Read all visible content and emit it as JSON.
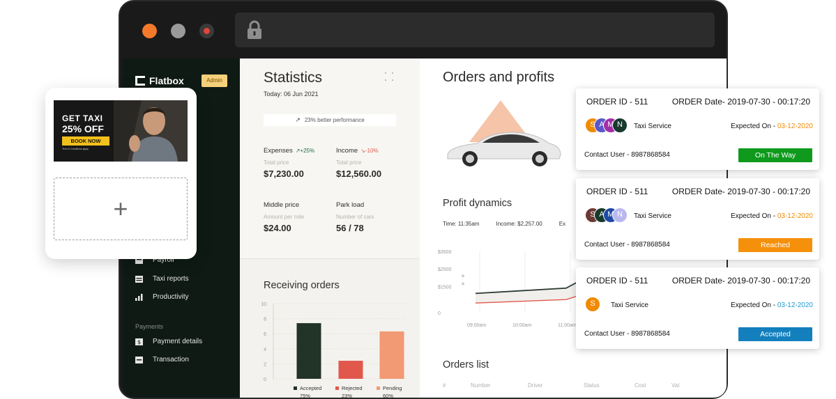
{
  "sidebar": {
    "brand": "Flatbox",
    "role_badge": "Admin",
    "items": [
      {
        "label": "Payroll",
        "icon": "payroll-icon"
      },
      {
        "label": "Taxi reports",
        "icon": "report-icon"
      },
      {
        "label": "Productivity",
        "icon": "bar-chart-icon"
      }
    ],
    "payments_section": "Payments",
    "payment_items": [
      {
        "label": "Payment details",
        "icon": "dollar-doc-icon"
      },
      {
        "label": "Transaction",
        "icon": "transaction-icon"
      }
    ]
  },
  "statistics": {
    "title": "Statistics",
    "today": "Today: 06 Jun 2021",
    "performance": "23% better performance",
    "expenses": {
      "label": "Expenses",
      "delta": "+25%",
      "sub": "Total price",
      "value": "$7,230.00"
    },
    "income": {
      "label": "Income",
      "delta": "-10%",
      "sub": "Total price",
      "value": "$12,560.00"
    },
    "middle_price": {
      "label": "Middle price",
      "sub": "Amount per mile",
      "value": "$24.00"
    },
    "park_load": {
      "label": "Park load",
      "sub": "Number of cars",
      "value": "56 / 78"
    },
    "receiving_title": "Receiving orders"
  },
  "receiving_chart": {
    "yticks": [
      "10",
      "8",
      "6",
      "4",
      "2",
      "0"
    ],
    "legend": [
      {
        "name": "Accepted",
        "pct": "75%",
        "color": "#223328"
      },
      {
        "name": "Rejected",
        "pct": "23%",
        "color": "#e2574c"
      },
      {
        "name": "Pending",
        "pct": "60%",
        "color": "#f19a73"
      }
    ]
  },
  "chart_data": [
    {
      "type": "bar",
      "title": "Receiving orders",
      "categories": [
        "Accepted",
        "Rejected",
        "Pending"
      ],
      "values": [
        7.4,
        2.4,
        6.3
      ],
      "ylim": [
        0,
        10
      ],
      "colors": [
        "#223328",
        "#e2574c",
        "#f19a73"
      ]
    },
    {
      "type": "line",
      "title": "Profit dynamics",
      "x": [
        "09:00am",
        "10:00am",
        "11:00am",
        "11:35am"
      ],
      "series": [
        {
          "values": [
            1100,
            1250,
            1400,
            2257
          ],
          "color": "#2b3a33"
        },
        {
          "values": [
            550,
            650,
            750,
            1250
          ],
          "color": "#e2574c"
        }
      ],
      "ylim": [
        0,
        3500
      ],
      "yticks": [
        "$3500",
        "$2500",
        "$1500",
        "0"
      ]
    }
  ],
  "orders": {
    "title": "Orders and profits",
    "profit_title": "Profit dynamics",
    "time_label": "Time: 11:35am",
    "income_label": "Income: $2,257.00",
    "extra_label": "Ex",
    "list_title": "Orders list",
    "columns": [
      "#",
      "Number",
      "Driver",
      "Status",
      "Cost",
      "Vat"
    ]
  },
  "ad": {
    "line1": "GET TAXI",
    "line2": "25% OFF",
    "cta": "BOOK NOW",
    "terms": "Term & Conditions apply",
    "upload_symbol": "+"
  },
  "order_cards": [
    {
      "order_id": "ORDER ID - 511",
      "order_date": "ORDER  Date- 2019-07-30 - 00:17:20",
      "service": "Taxi Service",
      "expected_label": "Expected On - ",
      "expected_date": "03-12-2020",
      "contact": "Contact User - 8987868584",
      "status": "On The Way",
      "status_color": "#0f9a1d",
      "avatars": [
        {
          "letter": "S",
          "color": "#f08a00"
        },
        {
          "letter": "A",
          "color": "#5b57c9"
        },
        {
          "letter": "M",
          "color": "#a12fa8"
        },
        {
          "letter": "N",
          "color": "#173a2e"
        }
      ]
    },
    {
      "order_id": "ORDER ID - 511",
      "order_date": "ORDER  Date- 2019-07-30 - 00:17:20",
      "service": "Taxi Service",
      "expected_label": "Expected On - ",
      "expected_date": "03-12-2020",
      "contact": "Contact User - 8987868584",
      "status": "Reached",
      "status_color": "#f5900a",
      "avatars": [
        {
          "letter": "S",
          "color": "#6b3a35"
        },
        {
          "letter": "A",
          "color": "#183a2c"
        },
        {
          "letter": "M",
          "color": "#1e4aa8"
        },
        {
          "letter": "N",
          "color": "#b9b8ee"
        }
      ]
    },
    {
      "order_id": "ORDER ID - 511",
      "order_date": "ORDER  Date- 2019-07-30 - 00:17:20",
      "service": "Taxi Service",
      "expected_label": "Expected On - ",
      "expected_date": "03-12-2020",
      "contact": "Contact User - 8987868584",
      "status": "Accepted",
      "status_color": "#147fbd",
      "avatars": [
        {
          "letter": "S",
          "color": "#f08a00"
        }
      ]
    }
  ]
}
